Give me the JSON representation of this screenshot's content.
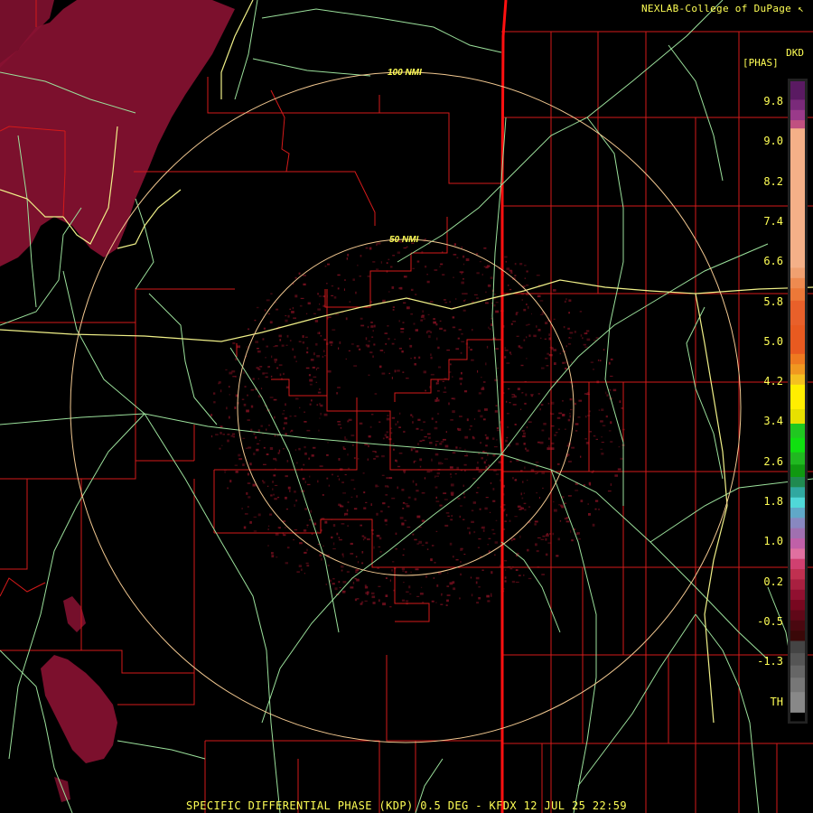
{
  "header": {
    "credit": "NEXLAB-College of DuPage",
    "credit_mark": "↖"
  },
  "legend": {
    "product": "DKD",
    "units": "[PHAS]",
    "ticks": [
      "9.8",
      "9.0",
      "8.2",
      "7.4",
      "6.6",
      "5.8",
      "5.0",
      "4.2",
      "3.4",
      "2.6",
      "1.8",
      "1.0",
      "0.2",
      "-0.5",
      "-1.3",
      "TH"
    ],
    "colors": {
      "frame": "#222222",
      "top": "#6a1e6e"
    }
  },
  "range_rings": [
    {
      "label": "100 NMI"
    },
    {
      "label": "50 NMI"
    }
  ],
  "footer": {
    "caption": "SPECIFIC DIFFERENTIAL PHASE (KDP) 0.5 DEG - KFDX 12 JUL 25 22:59"
  },
  "colors": {
    "county_lines": "#d41a1a",
    "state_line": "#ff1010",
    "highways": "#9be09b",
    "interstate": "#f0f088",
    "rings": "#f2c890",
    "precip": "#8a1232",
    "clutter": "#7a1020",
    "text": "#ffff55"
  }
}
